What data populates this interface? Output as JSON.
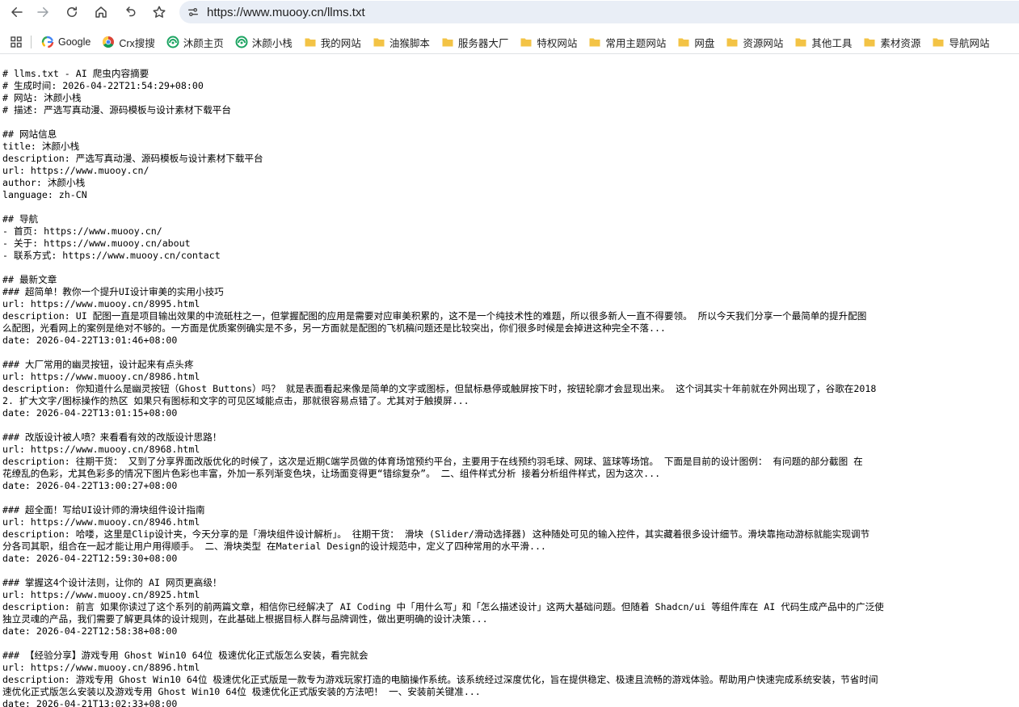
{
  "toolbar": {
    "back_icon": "arrow-left-icon",
    "forward_icon": "arrow-right-icon",
    "reload_icon": "reload-icon",
    "home_icon": "home-icon",
    "undo_icon": "undo-icon",
    "bookmark_star_icon": "star-icon",
    "site_info_icon": "tune-icon",
    "url": "https://www.muooy.cn/llms.txt"
  },
  "bookmarks": [
    {
      "label": "Google",
      "icon": "google-icon",
      "color": "#4285f4"
    },
    {
      "label": "Crx搜搜",
      "icon": "chrome-icon",
      "color": "#db4437"
    },
    {
      "label": "沐颜主页",
      "icon": "swirl-icon",
      "color": "#1da462"
    },
    {
      "label": "沐颜小栈",
      "icon": "swirl-icon",
      "color": "#1da462"
    },
    {
      "label": "我的网站",
      "icon": "folder-icon",
      "color": "#f3c345"
    },
    {
      "label": "油猴脚本",
      "icon": "folder-icon",
      "color": "#f3c345"
    },
    {
      "label": "服务器大厂",
      "icon": "folder-icon",
      "color": "#f3c345"
    },
    {
      "label": "特权网站",
      "icon": "folder-icon",
      "color": "#f3c345"
    },
    {
      "label": "常用主题网站",
      "icon": "folder-icon",
      "color": "#f3c345"
    },
    {
      "label": "网盘",
      "icon": "folder-icon",
      "color": "#f3c345"
    },
    {
      "label": "资源网站",
      "icon": "folder-icon",
      "color": "#f3c345"
    },
    {
      "label": "其他工具",
      "icon": "folder-icon",
      "color": "#f3c345"
    },
    {
      "label": "素材资源",
      "icon": "folder-icon",
      "color": "#f3c345"
    },
    {
      "label": "导航网站",
      "icon": "folder-icon",
      "color": "#f3c345"
    }
  ],
  "document": {
    "lines": [
      "# llms.txt - AI 爬虫内容摘要",
      "# 生成时间: 2026-04-22T21:54:29+08:00",
      "# 网站: 沐颜小栈",
      "# 描述: 严选写真动漫、源码模板与设计素材下载平台",
      "",
      "## 网站信息",
      "title: 沐颜小栈",
      "description: 严选写真动漫、源码模板与设计素材下载平台",
      "url: https://www.muooy.cn/",
      "author: 沐颜小栈",
      "language: zh-CN",
      "",
      "## 导航",
      "- 首页: https://www.muooy.cn/",
      "- 关于: https://www.muooy.cn/about",
      "- 联系方式: https://www.muooy.cn/contact",
      "",
      "## 最新文章",
      "### 超简单！教你一个提升UI设计审美的实用小技巧",
      "url: https://www.muooy.cn/8995.html",
      "description: UI 配图一直是项目输出效果的中流砥柱之一，但掌握配图的应用是需要对应审美积累的，这不是一个纯技术性的难题，所以很多新人一直不得要领。 所以今天我们分享一个最简单的提升配图",
      "么配图，光看网上的案例是绝对不够的。一方面是优质案例确实是不多，另一方面就是配图的飞机稿问题还是比较突出，你们很多时候是会掉进这种完全不落...",
      "date: 2026-04-22T13:01:46+08:00",
      "",
      "### 大厂常用的幽灵按钮，设计起来有点头疼",
      "url: https://www.muooy.cn/8986.html",
      "description: 你知道什么是幽灵按钮（Ghost Buttons）吗？ 就是表面看起来像是简单的文字或图标，但鼠标悬停或触屏按下时，按钮轮廓才会显现出来。 这个词其实十年前就在外网出现了，谷歌在2018",
      "2. 扩大文字/图标操作的热区 如果只有图标和文字的可见区域能点击，那就很容易点错了。尤其对于触摸屏...",
      "date: 2026-04-22T13:01:15+08:00",
      "",
      "### 改版设计被人喷？来看看有效的改版设计思路！",
      "url: https://www.muooy.cn/8968.html",
      "description: 往期干货： 又到了分享界面改版优化的时候了，这次是近期C端学员做的体育场馆预约平台，主要用于在线预约羽毛球、网球、篮球等场馆。 下面是目前的设计图例： 有问题的部分截图 在",
      "花缭乱的色彩，尤其色彩多的情况下图片色彩也丰富，外加一系列渐变色块，让场面变得更“错综复杂”。 二、组件样式分析 接着分析组件样式，因为这次...",
      "date: 2026-04-22T13:00:27+08:00",
      "",
      "### 超全面！写给UI设计师的滑块组件设计指南",
      "url: https://www.muooy.cn/8946.html",
      "description: 哈喽，这里是Clip设计夹，今天分享的是「滑块组件设计解析」。 往期干货： 滑块 (Slider/滑动选择器) 这种随处可见的输入控件，其实藏着很多设计细节。滑块靠拖动游标就能实现调节",
      "分各司其职，组合在一起才能让用户用得顺手。 二、滑块类型 在Material Design的设计规范中，定义了四种常用的水平滑...",
      "date: 2026-04-22T12:59:30+08:00",
      "",
      "### 掌握这4个设计法则，让你的 AI 网页更高级！",
      "url: https://www.muooy.cn/8925.html",
      "description: 前言 如果你读过了这个系列的前两篇文章，相信你已经解决了 AI Coding 中「用什么写」和「怎么描述设计」这两大基础问题。但随着 Shadcn/ui 等组件库在 AI 代码生成产品中的广泛使",
      "独立灵魂的产品，我们需要了解更具体的设计规则，在此基础上根据目标人群与品牌调性，做出更明确的设计决策...",
      "date: 2026-04-22T12:58:38+08:00",
      "",
      "### 【经验分享】游戏专用 Ghost Win10 64位 极速优化正式版怎么安装，看完就会",
      "url: https://www.muooy.cn/8896.html",
      "description: 游戏专用 Ghost Win10 64位 极速优化正式版是一款专为游戏玩家打造的电脑操作系统。该系统经过深度优化，旨在提供稳定、极速且流畅的游戏体验。帮助用户快速完成系统安装，节省时间",
      "速优化正式版怎么安装以及游戏专用 Ghost Win10 64位 极速优化正式版安装的方法吧！ 一、安装前关键准...",
      "date: 2026-04-21T13:02:33+08:00"
    ]
  }
}
